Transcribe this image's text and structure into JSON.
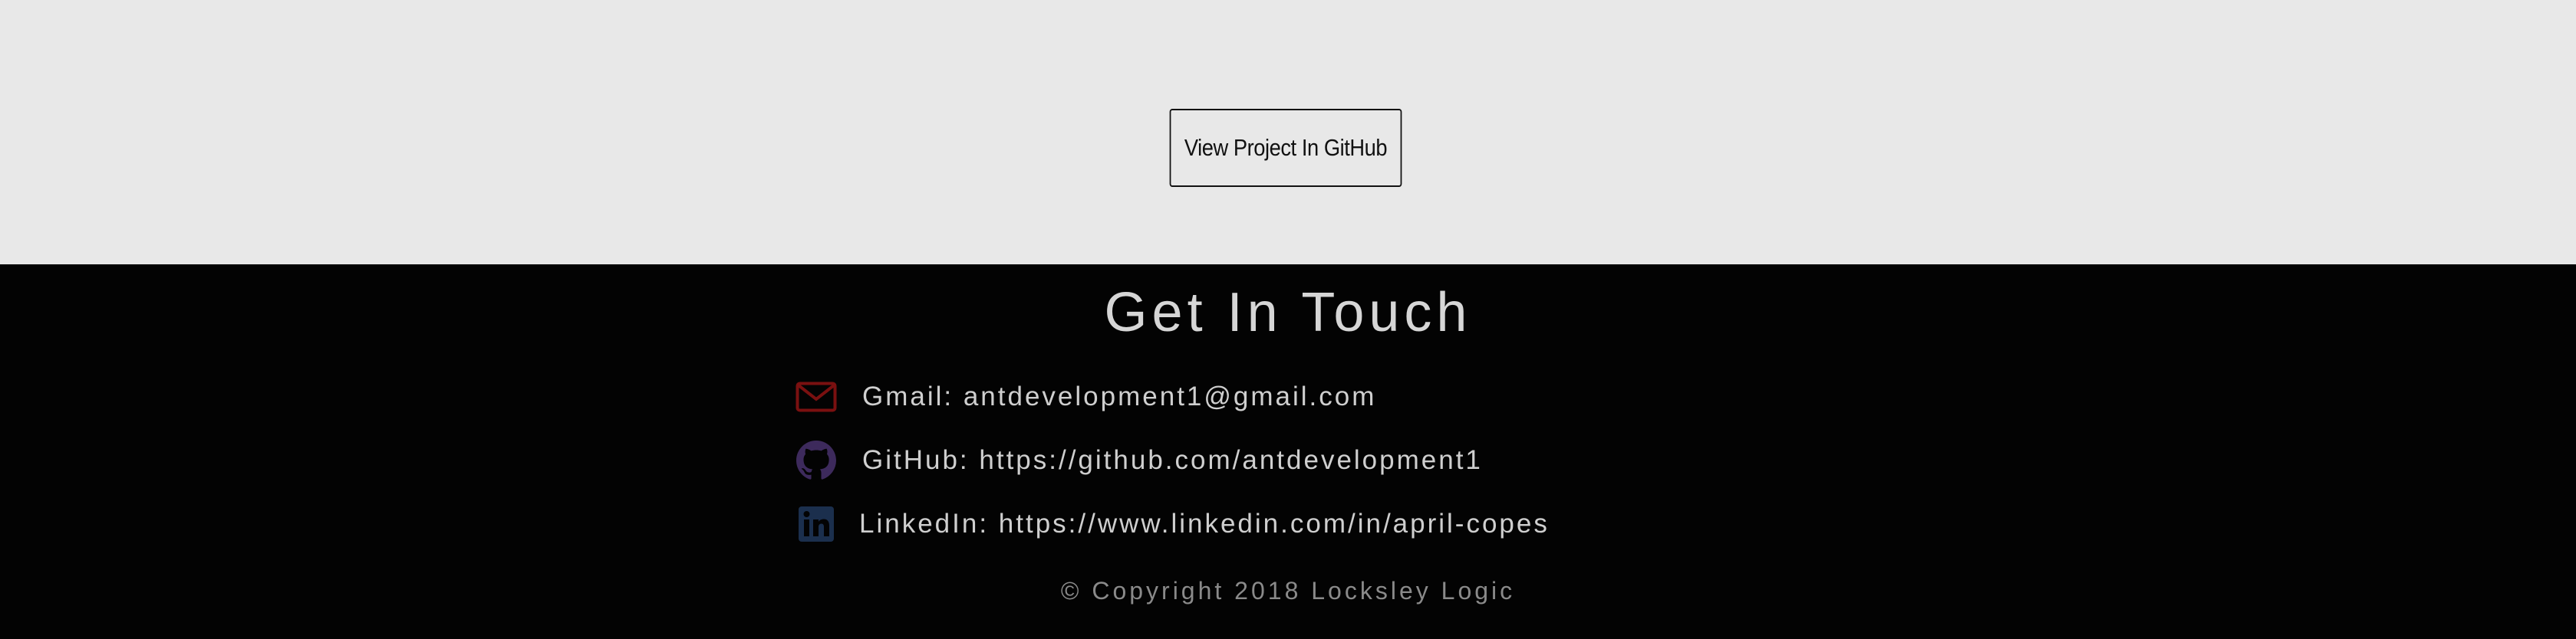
{
  "project": {
    "github_button_label": "View Project In GitHub"
  },
  "footer": {
    "title": "Get In Touch",
    "contacts": [
      {
        "icon": "envelope-icon",
        "color": "#7a1010",
        "label": "Gmail: antdevelopment1@gmail.com"
      },
      {
        "icon": "github-icon",
        "color": "#3d2a5c",
        "label": "GitHub: https://github.com/antdevelopment1"
      },
      {
        "icon": "linkedin-icon",
        "color": "#1b2f4d",
        "label": "LinkedIn: https://www.linkedin.com/in/april-copes"
      }
    ],
    "copyright": "© Copyright 2018 Locksley Logic"
  },
  "colors": {
    "project_bg": "#e8e8e8",
    "footer_bg": "#030303",
    "footer_text": "#cfcfcf"
  }
}
